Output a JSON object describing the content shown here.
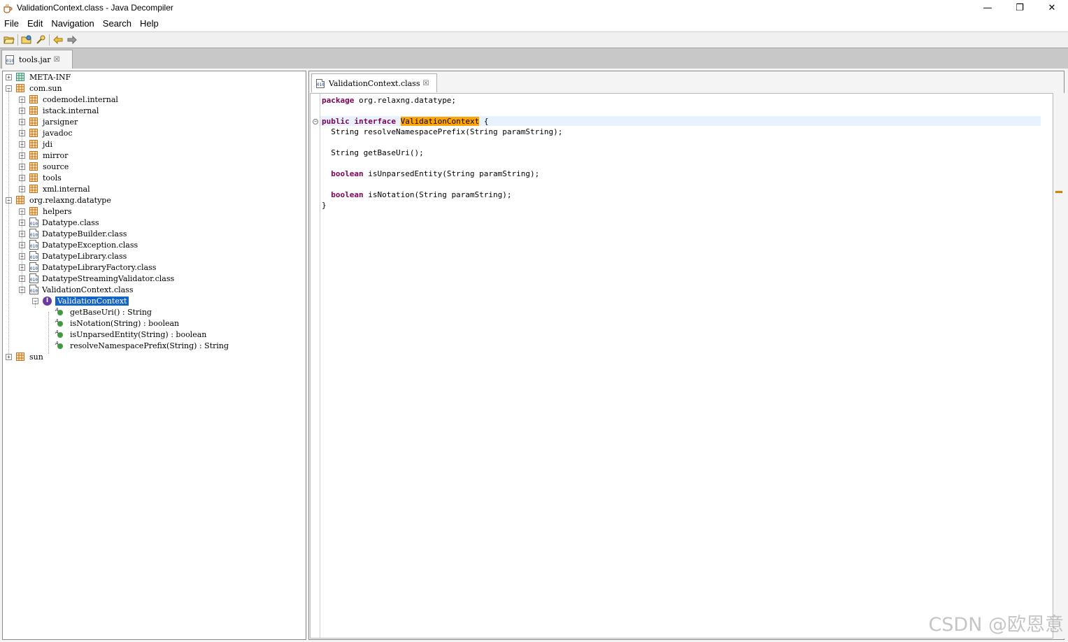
{
  "window": {
    "title": "ValidationContext.class - Java Decompiler",
    "controls": {
      "minimize": "—",
      "maximize": "❐",
      "close": "✕"
    }
  },
  "menu": [
    "File",
    "Edit",
    "Navigation",
    "Search",
    "Help"
  ],
  "toolbar": {
    "icons": [
      "open-file-icon",
      "open-folder-icon",
      "search-icon",
      "back-arrow-icon",
      "forward-arrow-icon"
    ]
  },
  "outer_tab": {
    "label": "tools.jar",
    "close": "☒"
  },
  "editor_tab": {
    "label": "ValidationContext.class",
    "close": "☒"
  },
  "tree": [
    {
      "label": "META-INF",
      "type": "package",
      "level": 0,
      "expander": "+",
      "teal": true
    },
    {
      "label": "com.sun",
      "type": "package",
      "level": 0,
      "expander": "−"
    },
    {
      "label": "codemodel.internal",
      "type": "package",
      "level": 1,
      "expander": "+"
    },
    {
      "label": "istack.internal",
      "type": "package",
      "level": 1,
      "expander": "+"
    },
    {
      "label": "jarsigner",
      "type": "package",
      "level": 1,
      "expander": "+"
    },
    {
      "label": "javadoc",
      "type": "package",
      "level": 1,
      "expander": "+"
    },
    {
      "label": "jdi",
      "type": "package",
      "level": 1,
      "expander": "+"
    },
    {
      "label": "mirror",
      "type": "package",
      "level": 1,
      "expander": "+"
    },
    {
      "label": "source",
      "type": "package",
      "level": 1,
      "expander": "+"
    },
    {
      "label": "tools",
      "type": "package",
      "level": 1,
      "expander": "+"
    },
    {
      "label": "xml.internal",
      "type": "package",
      "level": 1,
      "expander": "+"
    },
    {
      "label": "org.relaxng.datatype",
      "type": "package",
      "level": 0,
      "expander": "−"
    },
    {
      "label": "helpers",
      "type": "package",
      "level": 1,
      "expander": "+"
    },
    {
      "label": "Datatype.class",
      "type": "class",
      "level": 1,
      "expander": "+"
    },
    {
      "label": "DatatypeBuilder.class",
      "type": "class",
      "level": 1,
      "expander": "+"
    },
    {
      "label": "DatatypeException.class",
      "type": "class",
      "level": 1,
      "expander": "+"
    },
    {
      "label": "DatatypeLibrary.class",
      "type": "class",
      "level": 1,
      "expander": "+"
    },
    {
      "label": "DatatypeLibraryFactory.class",
      "type": "class",
      "level": 1,
      "expander": "+"
    },
    {
      "label": "DatatypeStreamingValidator.class",
      "type": "class",
      "level": 1,
      "expander": "+"
    },
    {
      "label": "ValidationContext.class",
      "type": "class",
      "level": 1,
      "expander": "−"
    },
    {
      "label": "ValidationContext",
      "type": "interface",
      "level": 2,
      "expander": "−",
      "selected": true
    },
    {
      "label": "getBaseUri()  : String",
      "type": "method",
      "level": 3
    },
    {
      "label": "isNotation(String)  : boolean",
      "type": "method",
      "level": 3
    },
    {
      "label": "isUnparsedEntity(String)  : boolean",
      "type": "method",
      "level": 3
    },
    {
      "label": "resolveNamespacePrefix(String)  : String",
      "type": "method",
      "level": 3
    },
    {
      "label": "sun",
      "type": "package",
      "level": 0,
      "expander": "+"
    }
  ],
  "code": {
    "line1": {
      "kw": "package",
      "rest": " org.relaxng.datatype;"
    },
    "line2": {
      "kw1": "public",
      "kw2": "interface",
      "name": "ValidationContext",
      "rest": " {"
    },
    "line3": "  String resolveNamespacePrefix(String paramString);",
    "line4": "  String getBaseUri();",
    "line5": {
      "kw": "boolean",
      "rest": " isUnparsedEntity(String paramString);"
    },
    "line6": {
      "kw": "boolean",
      "rest": " isNotation(String paramString);"
    },
    "line7": "}"
  },
  "watermark": "CSDN @欧恩意",
  "colors": {
    "selection": "#1464c8",
    "keyword": "#7f0055",
    "highlight": "#ffa500"
  }
}
